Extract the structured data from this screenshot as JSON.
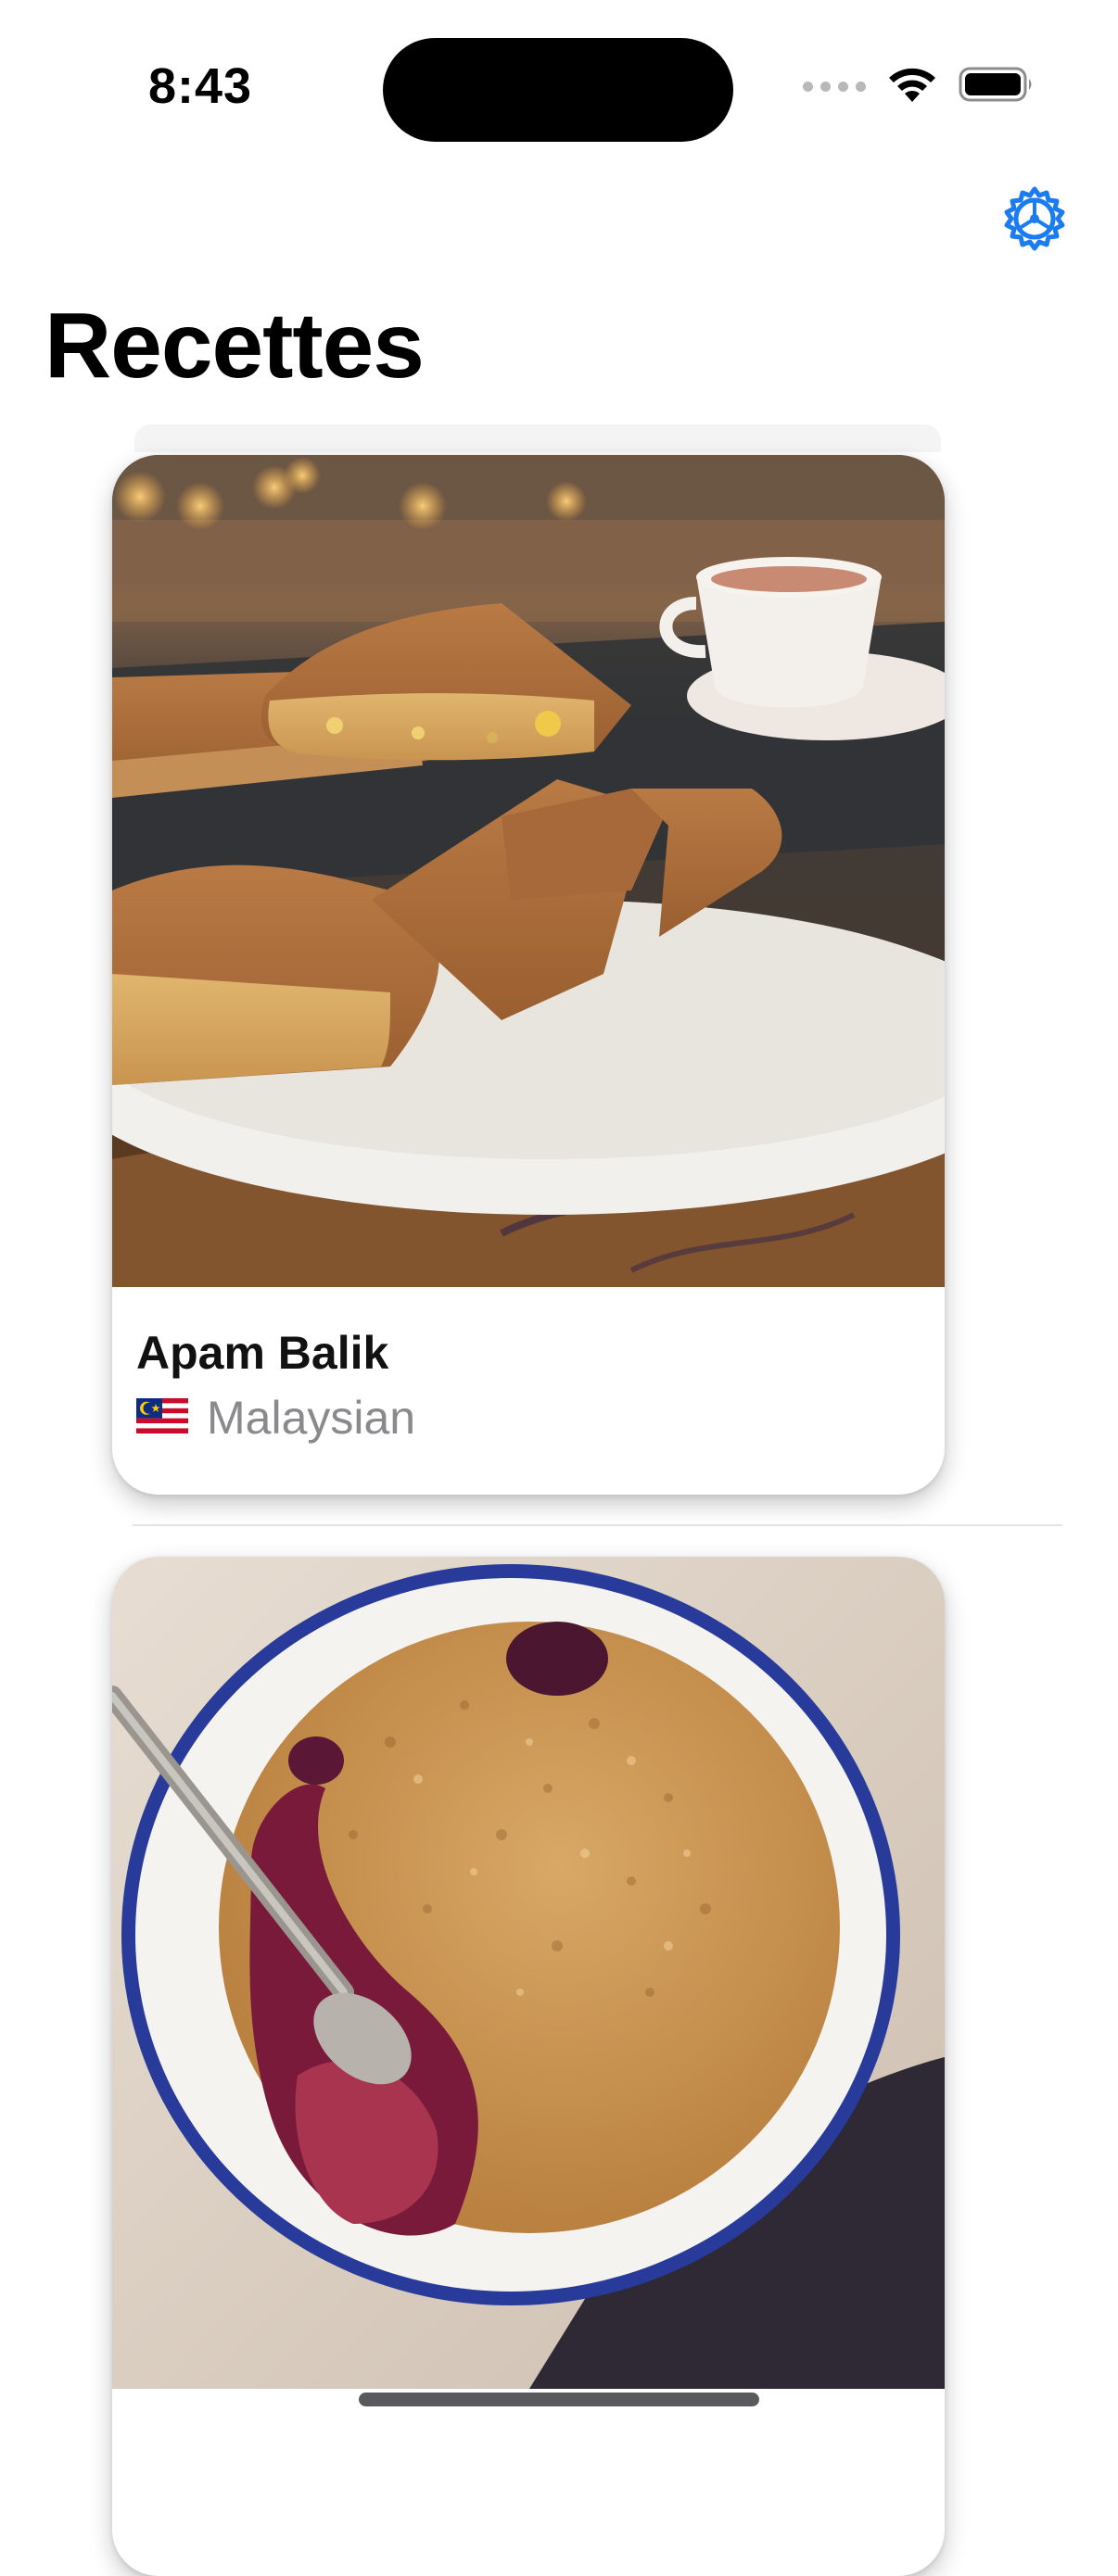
{
  "status_bar": {
    "time": "8:43"
  },
  "header": {
    "title": "Recettes",
    "settings_icon": "gear-icon",
    "accent_color": "#1a7cf0"
  },
  "recipes": [
    {
      "name": "Apam Balik",
      "cuisine": "Malaysian",
      "flag_icon": "malaysia-flag-icon",
      "photo_icon": "apam-balik-photo"
    },
    {
      "name": "",
      "cuisine": "",
      "photo_icon": "berry-crumble-photo"
    }
  ]
}
